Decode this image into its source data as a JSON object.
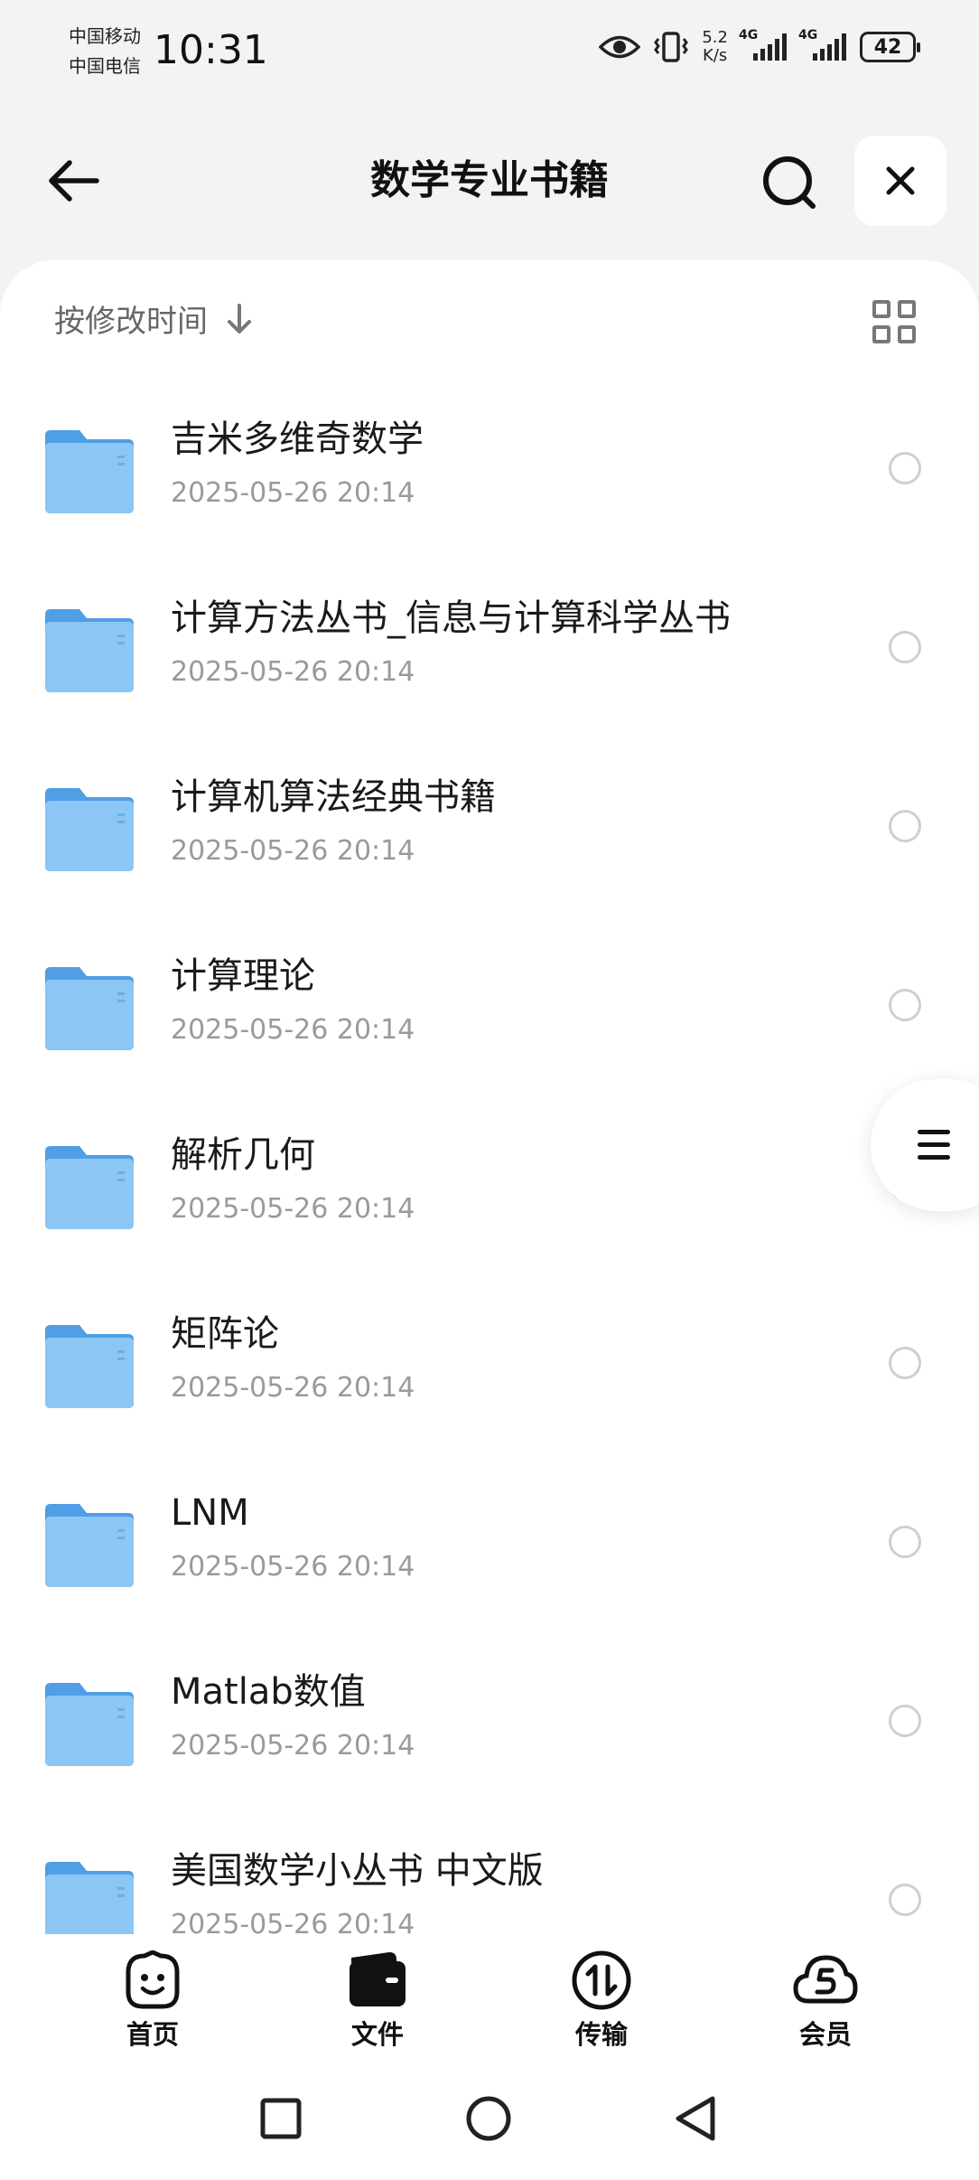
{
  "status_bar": {
    "carrier_1": "中国移动",
    "carrier_2": "中国电信",
    "time": "10:31",
    "net_speed_value": "5.2",
    "net_speed_unit": "K/s",
    "signal_1": "4G",
    "signal_2": "4G",
    "battery": "42"
  },
  "header": {
    "title": "数学专业书籍"
  },
  "toolbar": {
    "sort_label": "按修改时间"
  },
  "files": [
    {
      "name": "吉米多维奇数学",
      "date": "2025-05-26 20:14"
    },
    {
      "name": "计算方法丛书_信息与计算科学丛书",
      "date": "2025-05-26 20:14"
    },
    {
      "name": "计算机算法经典书籍",
      "date": "2025-05-26 20:14"
    },
    {
      "name": "计算理论",
      "date": "2025-05-26 20:14"
    },
    {
      "name": "解析几何",
      "date": "2025-05-26 20:14"
    },
    {
      "name": "矩阵论",
      "date": "2025-05-26 20:14"
    },
    {
      "name": "LNM",
      "date": "2025-05-26 20:14"
    },
    {
      "name": "Matlab数值",
      "date": "2025-05-26 20:14"
    },
    {
      "name": "美国数学小丛书 中文版",
      "date": "2025-05-26 20:14"
    }
  ],
  "bottom_nav": [
    {
      "label": "首页",
      "icon": "smile-face-icon"
    },
    {
      "label": "文件",
      "icon": "folder-wallet-icon"
    },
    {
      "label": "传输",
      "icon": "transfer-icon"
    },
    {
      "label": "会员",
      "icon": "cloud-vip-icon"
    }
  ],
  "colors": {
    "background": "#f3f3f3",
    "surface": "#ffffff",
    "folder_blue": "#6fb3ee",
    "text_primary": "#1a1a1a",
    "text_secondary": "#9a9a9a"
  }
}
